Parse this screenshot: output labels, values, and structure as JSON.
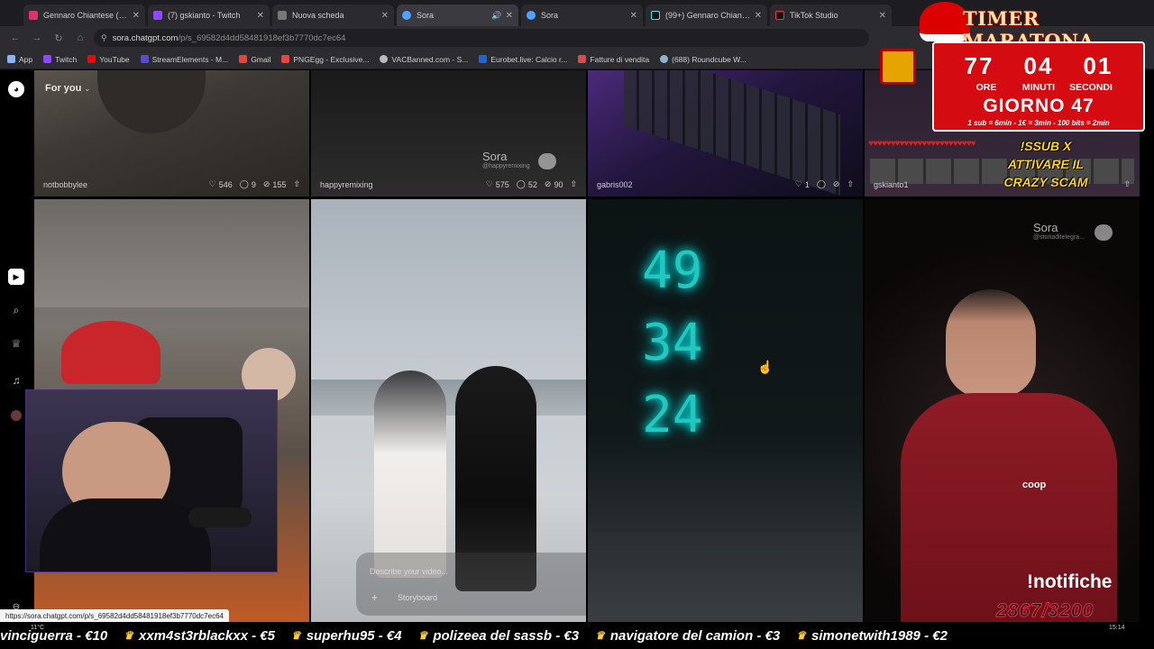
{
  "tabs": [
    {
      "title": "Gennaro Chiantese (@gskianto)",
      "color": "#e1306c",
      "active": false
    },
    {
      "title": "(7) gskianto - Twitch",
      "color": "#9146ff",
      "active": false
    },
    {
      "title": "Nuova scheda",
      "color": "#777777",
      "active": false
    },
    {
      "title": "Sora",
      "color": "#4da3ff",
      "active": true
    },
    {
      "title": "Sora",
      "color": "#4da3ff",
      "active": false
    },
    {
      "title": "(99+) Gennaro Chiantese",
      "color": "#222222",
      "active": false
    },
    {
      "title": "TikTok Studio",
      "color": "#222222",
      "active": false
    }
  ],
  "address": {
    "host": "sora.chatgpt.com",
    "path": "/p/s_69582d4dd58481918ef3b7770dc7ec64"
  },
  "bookmarks": [
    {
      "label": "App",
      "color": "#8ab4f8"
    },
    {
      "label": "Twitch",
      "color": "#9146ff"
    },
    {
      "label": "YouTube",
      "color": "#ff0000"
    },
    {
      "label": "StreamElements - M...",
      "color": "#5a4ad1"
    },
    {
      "label": "Gmail",
      "color": "#ea4335"
    },
    {
      "label": "PNGEgg - Exclusive...",
      "color": "#e8453c"
    },
    {
      "label": "VACBanned.com - S...",
      "color": "#bbbbbb"
    },
    {
      "label": "Eurobet.live: Calcio r...",
      "color": "#1e63d8"
    },
    {
      "label": "Fatture di vendita",
      "color": "#e04848"
    },
    {
      "label": "(688) Roundcube W...",
      "color": "#8fb3c9"
    }
  ],
  "feed": {
    "label": "For you",
    "row1": [
      {
        "user": "notbobbylee",
        "likes": "546",
        "comments": "9",
        "remixes": "155"
      },
      {
        "user": "happyremixing",
        "likes": "575",
        "comments": "52",
        "remixes": "90"
      },
      {
        "user": "gabris002",
        "likes": "1",
        "comments": "",
        "remixes": ""
      },
      {
        "user": "gskianto1",
        "likes": "",
        "comments": "",
        "remixes": ""
      }
    ],
    "watermark": "Sora",
    "watermark_sub1": "@happyremixing",
    "watermark_sub2": "@storiaditelegra...",
    "digits": [
      "49",
      "34",
      "24"
    ],
    "composer_placeholder": "Describe your video...",
    "storyboard_label": "Storyboard",
    "shirt_logo": "coop"
  },
  "overlay": {
    "timer_title": "TIMER MARATONA",
    "hours": "77",
    "minutes": "04",
    "seconds": "01",
    "unit_hours": "ORE",
    "unit_minutes": "MINUTI",
    "unit_seconds": "SECONDI",
    "day": "GIORNO 47",
    "rule": "1 sub = 6min - 1€ = 3min - 100 bits = 2min",
    "sub_text_1": "!SSUB X",
    "sub_text_2": "ATTIVARE IL",
    "sub_text_3": "CRAZY SCAM",
    "notifiche": "!notifiche",
    "goal": "2867/3200"
  },
  "status_url": "https://sora.chatgpt.com/p/s_69582d4dd58481918ef3b7770dc7ec64",
  "ticker": [
    "vinciguerra - €10",
    "xxm4st3rblackxx - €5",
    "superhu95 - €4",
    "polizeea del sassb - €3",
    "navigatore del camion - €3",
    "simonetwith1989 - €2"
  ],
  "weather": "11°C",
  "clock": "15:14"
}
